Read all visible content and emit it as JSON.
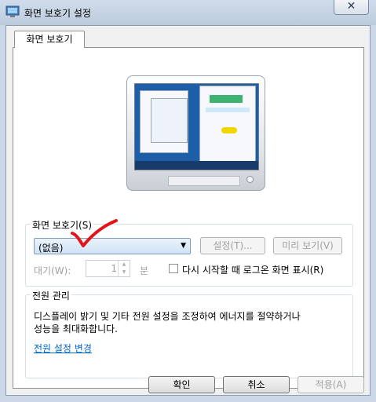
{
  "window": {
    "title": "화면 보호기 설정",
    "close_glyph": "✕"
  },
  "tab": {
    "label": "화면 보호기"
  },
  "screensaver": {
    "group_label": "화면 보호기(S)",
    "selected": "(없음)",
    "settings_button": "설정(T)...",
    "preview_button": "미리 보기(V)",
    "wait_label": "대기(W):",
    "wait_value": "1",
    "wait_unit": "분",
    "logon_checkbox_label": "다시 시작할 때 로그온 화면 표시(R)",
    "logon_checked": false
  },
  "power": {
    "group_label": "전원 관리",
    "description_line1": "디스플레이 밝기 및 기타 전원 설정을 조정하여 에너지를 절약하거나",
    "description_line2": "성능을 최대화합니다.",
    "link": "전원 설정 변경"
  },
  "footer": {
    "ok_button": "확인",
    "cancel_button": "취소",
    "apply_button": "적용(A)"
  },
  "colors": {
    "checkmark_annotation": "#e0141b",
    "link": "#0066cc"
  }
}
